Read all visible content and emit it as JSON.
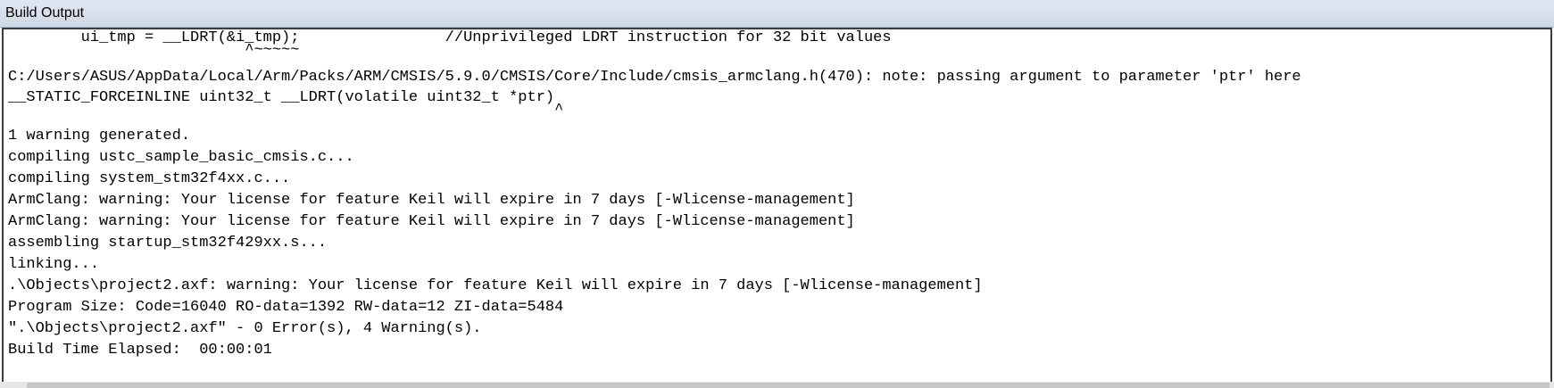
{
  "window": {
    "title": "Build Output"
  },
  "output": {
    "lines": [
      "        ui_tmp = __LDRT(&i_tmp);                //Unprivileged LDRT instruction for 32 bit values",
      "                          ^~~~~~",
      "C:/Users/ASUS/AppData/Local/Arm/Packs/ARM/CMSIS/5.9.0/CMSIS/Core/Include/cmsis_armclang.h(470): note: passing argument to parameter 'ptr' here",
      "__STATIC_FORCEINLINE uint32_t __LDRT(volatile uint32_t *ptr)",
      "                                                            ^",
      "1 warning generated.",
      "compiling ustc_sample_basic_cmsis.c...",
      "compiling system_stm32f4xx.c...",
      "ArmClang: warning: Your license for feature Keil will expire in 7 days [-Wlicense-management]",
      "ArmClang: warning: Your license for feature Keil will expire in 7 days [-Wlicense-management]",
      "assembling startup_stm32f429xx.s...",
      "linking...",
      ".\\Objects\\project2.axf: warning: Your license for feature Keil will expire in 7 days [-Wlicense-management]",
      "Program Size: Code=16040 RO-data=1392 RW-data=12 ZI-data=5484",
      "\".\\Objects\\project2.axf\" - 0 Error(s), 4 Warning(s).",
      "Build Time Elapsed:  00:00:01"
    ]
  }
}
